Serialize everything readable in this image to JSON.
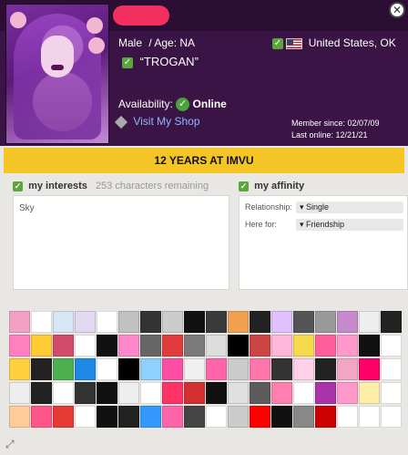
{
  "profile": {
    "gender": "Male",
    "age_text": "/ Age: NA",
    "location": "United States, OK",
    "tagline": "“TROGAN”",
    "availability_label": "Availability:",
    "availability_status": "Online",
    "shop_link": "Visit My Shop",
    "member_since": "Member since: 02/07/09",
    "last_online": "Last online: 12/21/21"
  },
  "banner": "12 YEARS AT IMVU",
  "interests": {
    "title": "my interests",
    "remaining": "253 characters remaining",
    "text": "Sky"
  },
  "affinity": {
    "title": "my affinity",
    "relationship_label": "Relationship:",
    "relationship_value": "Single",
    "herefor_label": "Here for:",
    "herefor_value": "Friendship"
  },
  "stickers": [
    "#f2a1c6",
    "#ffffff",
    "#d6e6f5",
    "#e4d7f0",
    "#ffffff",
    "#c1c1c1",
    "#333333",
    "#cccccc",
    "#111111",
    "#3a3a3a",
    "#f0a050",
    "#222222",
    "#e0c0ff",
    "#555555",
    "#999999",
    "#c48acb",
    "#eeeeee",
    "#222222",
    "#ff7fbf",
    "#ffcc33",
    "#d14b6a",
    "#ffffff",
    "#111111",
    "#ff88cc",
    "#666666",
    "#e23b3b",
    "#7a7a7a",
    "#dddddd",
    "#000000",
    "#cc4444",
    "#ffb6d9",
    "#f7d94c",
    "#ff5e9c",
    "#ff99cc",
    "#111111",
    "#ffffff",
    "#ffcf3f",
    "#222222",
    "#4caf50",
    "#1e88e5",
    "#ffffff",
    "#000000",
    "#8ed1fc",
    "#ff4da6",
    "#f0f0f0",
    "#ff66aa",
    "#cccccc",
    "#ff77aa",
    "#333333",
    "#ffd1e8",
    "#222222",
    "#f3a6c4",
    "#ff0066",
    "#ffffff",
    "#eeeeee",
    "#222222",
    "#ffffff",
    "#333333",
    "#111111",
    "#eeeeee",
    "#ffffff",
    "#ff3366",
    "#d32f2f",
    "#111111",
    "#e0e0e0",
    "#5c5c5c",
    "#ff80b0",
    "#ffffff",
    "#aa33aa",
    "#ff99cc",
    "#ffeeaa",
    "#ffffff",
    "#ffcc99",
    "#ff5588",
    "#e53935",
    "#ffffff",
    "#111111",
    "#222222",
    "#3399ff",
    "#ff66aa",
    "#444444",
    "#ffffff",
    "#cccccc",
    "#ff0000",
    "#111111",
    "#888888",
    "#cc0000",
    "#ffffff",
    "#ffffff",
    "#ffffff"
  ]
}
